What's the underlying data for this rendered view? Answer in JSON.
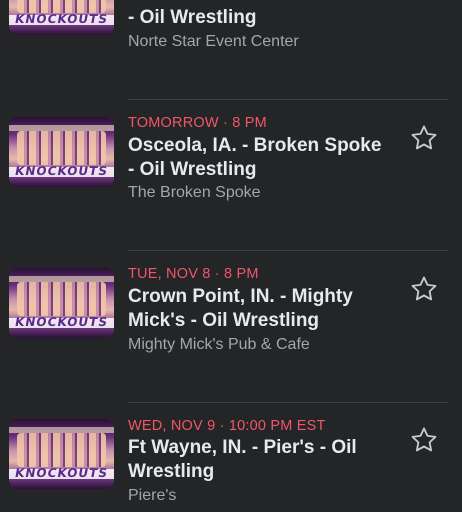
{
  "events": [
    {
      "date": "",
      "title": "- Oil Wrestling",
      "venue": "Norte Star Event Center",
      "image_text": "KNOCKOUTS",
      "interested_icon": "star-icon"
    },
    {
      "date": "TOMORROW · 8 PM",
      "title": "Osceola, IA. - Broken Spoke - Oil Wrestling",
      "venue": "The Broken Spoke",
      "image_text": "KNOCKOUTS",
      "interested_icon": "star-icon"
    },
    {
      "date": "TUE, NOV 8 · 8 PM",
      "title": "Crown Point, IN. - Mighty Mick's - Oil Wrestling",
      "venue": "Mighty Mick's Pub & Cafe",
      "image_text": "KNOCKOUTS",
      "interested_icon": "star-icon"
    },
    {
      "date": "WED, NOV 9 · 10:00 PM EST",
      "title": "Ft Wayne, IN. - Pier's - Oil Wrestling",
      "venue": "Piere's",
      "image_text": "KNOCKOUTS",
      "interested_icon": "star-icon"
    }
  ],
  "colors": {
    "background": "#242526",
    "date_accent": "#f0566a",
    "title": "#e8e9ec",
    "venue": "#a3a6ab",
    "divider": "#3e4042"
  }
}
